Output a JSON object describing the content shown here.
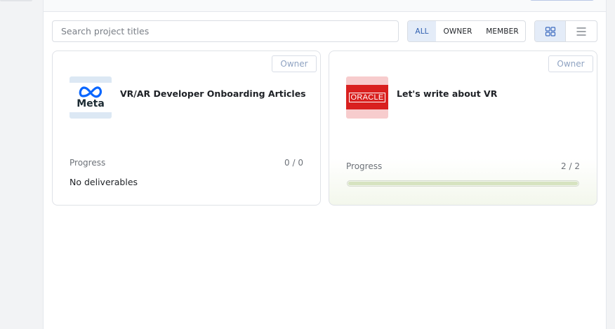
{
  "search": {
    "placeholder": "Search project titles"
  },
  "filters": {
    "all": "ALL",
    "owner": "OWNER",
    "member": "MEMBER",
    "selected": "ALL"
  },
  "view": {
    "selected": "grid",
    "options": [
      "grid-icon",
      "list-icon"
    ]
  },
  "colors": {
    "accent": "#2f5fb0",
    "selected_bg": "#e4ecf8",
    "progress_fill": "#d6e3c0"
  },
  "projects": [
    {
      "role": "Owner",
      "logo_text": "Meta",
      "title": "VR/AR Developer Onboarding Articles",
      "progress_label": "Progress",
      "progress_count": "0 / 0",
      "deliverables_note": "No deliverables"
    },
    {
      "role": "Owner",
      "logo_text": "ORACLE",
      "title": "Let's write about VR",
      "progress_label": "Progress",
      "progress_count": "2 / 2",
      "progress_fraction": 1.0
    }
  ]
}
